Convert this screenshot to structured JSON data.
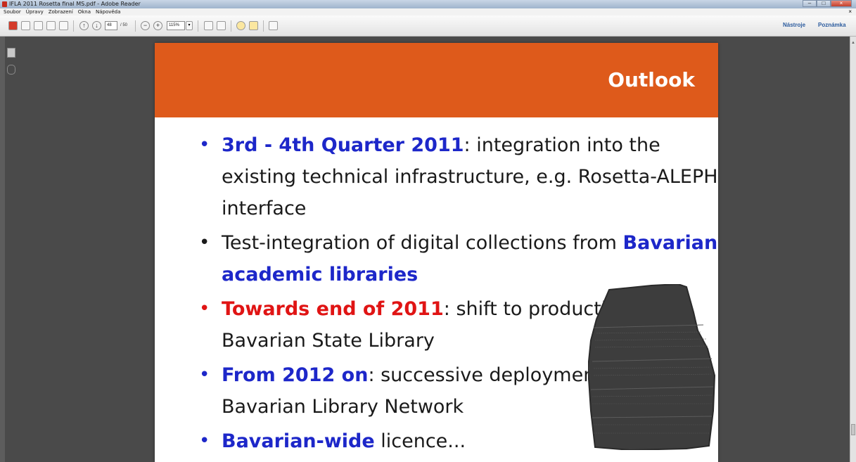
{
  "window": {
    "title": "IFLA 2011 Rosetta final MS.pdf - Adobe Reader",
    "controls": [
      "minimize-icon",
      "maximize-icon",
      "close-icon"
    ]
  },
  "menu": {
    "items": [
      "Soubor",
      "Úpravy",
      "Zobrazení",
      "Okna",
      "Nápověda"
    ]
  },
  "toolbar": {
    "page_current": "48",
    "page_total": "/ 50",
    "zoom": "115%",
    "tools_label": "Nástroje",
    "comments_label": "Poznámka"
  },
  "slide": {
    "title": "Outlook",
    "bullets": [
      {
        "highlight": "3rd - 4th Quarter 2011",
        "rest": ": integration into the existing technical infrastructure, e.g. Rosetta-ALEPH interface"
      },
      {
        "lead": "Test-integration of digital collections from ",
        "highlight": "Bavarian academic libraries"
      },
      {
        "highlight": "Towards end of 2011",
        "rest": ": shift to production in Bavarian State Library"
      },
      {
        "highlight": "From 2012 on",
        "rest": ": successive deployment in the Bavarian Library Network"
      },
      {
        "highlight": "Bavarian-wide",
        "rest": " licence..."
      }
    ],
    "image": "rosetta-stone-icon"
  },
  "colors": {
    "banner": "#de5a1b",
    "blue_highlight": "#1d27c9",
    "red_highlight": "#e01414",
    "viewer_background": "#4a4a4a"
  }
}
